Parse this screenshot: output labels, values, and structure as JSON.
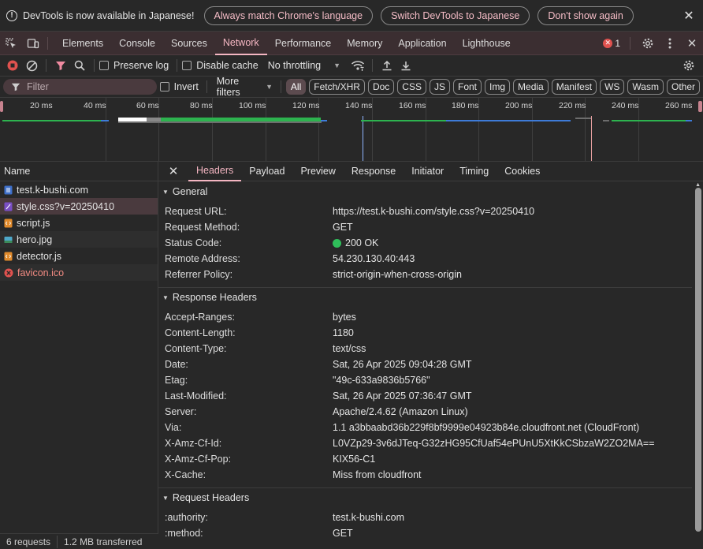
{
  "infobar": {
    "message": "DevTools is now available in Japanese!",
    "btn_match": "Always match Chrome's language",
    "btn_switch": "Switch DevTools to Japanese",
    "btn_dont_show": "Don't show again"
  },
  "main_tabs": [
    "Elements",
    "Console",
    "Sources",
    "Network",
    "Performance",
    "Memory",
    "Application",
    "Lighthouse"
  ],
  "active_main_tab": "Network",
  "error_count": "1",
  "toolbar": {
    "preserve_log": "Preserve log",
    "disable_cache": "Disable cache",
    "throttling": "No throttling"
  },
  "filter": {
    "placeholder": "Filter",
    "invert": "Invert",
    "more_filters": "More filters",
    "types": [
      "All",
      "Fetch/XHR",
      "Doc",
      "CSS",
      "JS",
      "Font",
      "Img",
      "Media",
      "Manifest",
      "WS",
      "Wasm",
      "Other"
    ]
  },
  "overview_ticks": [
    "20 ms",
    "40 ms",
    "60 ms",
    "80 ms",
    "100 ms",
    "120 ms",
    "140 ms",
    "160 ms",
    "180 ms",
    "200 ms",
    "220 ms",
    "240 ms",
    "260 ms"
  ],
  "request_list": {
    "header": "Name",
    "items": [
      {
        "name": "test.k-bushi.com",
        "type": "doc"
      },
      {
        "name": "style.css?v=20250410",
        "type": "css"
      },
      {
        "name": "script.js",
        "type": "js"
      },
      {
        "name": "hero.jpg",
        "type": "img"
      },
      {
        "name": "detector.js",
        "type": "js"
      },
      {
        "name": "favicon.ico",
        "type": "error"
      }
    ],
    "selected": "style.css?v=20250410"
  },
  "status": {
    "requests": "6 requests",
    "transferred": "1.2 MB transferred"
  },
  "detail_tabs": [
    "Headers",
    "Payload",
    "Preview",
    "Response",
    "Initiator",
    "Timing",
    "Cookies"
  ],
  "general": {
    "title": "General",
    "rows": [
      {
        "k": "Request URL:",
        "v": "https://test.k-bushi.com/style.css?v=20250410"
      },
      {
        "k": "Request Method:",
        "v": "GET"
      },
      {
        "k": "Status Code:",
        "v": "200 OK"
      },
      {
        "k": "Remote Address:",
        "v": "54.230.130.40:443"
      },
      {
        "k": "Referrer Policy:",
        "v": "strict-origin-when-cross-origin"
      }
    ]
  },
  "response_headers": {
    "title": "Response Headers",
    "rows": [
      {
        "k": "Accept-Ranges:",
        "v": "bytes"
      },
      {
        "k": "Content-Length:",
        "v": "1180"
      },
      {
        "k": "Content-Type:",
        "v": "text/css"
      },
      {
        "k": "Date:",
        "v": "Sat, 26 Apr 2025 09:04:28 GMT"
      },
      {
        "k": "Etag:",
        "v": "\"49c-633a9836b5766\""
      },
      {
        "k": "Last-Modified:",
        "v": "Sat, 26 Apr 2025 07:36:47 GMT"
      },
      {
        "k": "Server:",
        "v": "Apache/2.4.62 (Amazon Linux)"
      },
      {
        "k": "Via:",
        "v": "1.1 a3bbaabd36b229f8bf9999e04923b84e.cloudfront.net (CloudFront)"
      },
      {
        "k": "X-Amz-Cf-Id:",
        "v": "L0VZp29-3v6dJTeq-G32zHG95CfUaf54ePUnU5XtKkCSbzaW2ZO2MA=="
      },
      {
        "k": "X-Amz-Cf-Pop:",
        "v": "KIX56-C1"
      },
      {
        "k": "X-Cache:",
        "v": "Miss from cloudfront"
      }
    ]
  },
  "request_headers": {
    "title": "Request Headers",
    "rows": [
      {
        "k": ":authority:",
        "v": "test.k-bushi.com"
      },
      {
        "k": ":method:",
        "v": "GET"
      }
    ]
  },
  "colors": {
    "accent": "#f4b6c2",
    "status_ok": "#2fbf5a",
    "error": "#e0524f"
  }
}
